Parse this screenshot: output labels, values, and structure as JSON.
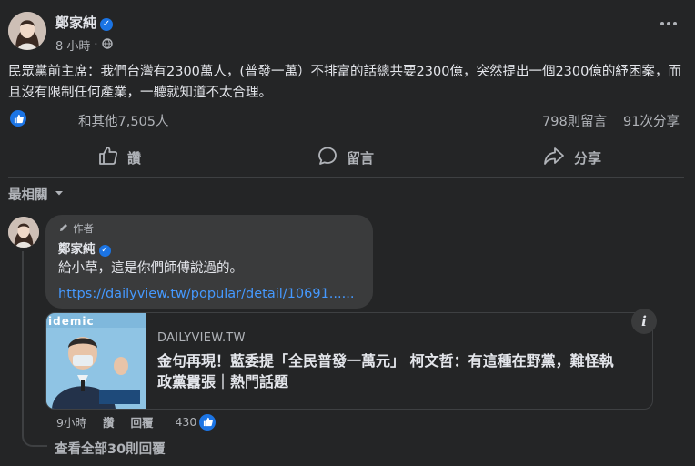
{
  "post": {
    "author": "鄭家純",
    "time": "8 小時",
    "text": "民眾黨前主席：我們台灣有2300萬人，(普發一萬）不排富的話總共要2300億，突然提出一個2300億的紓困案，而且沒有限制任何產業，一聽就知道不太合理。",
    "reactions": "和其他7,505人",
    "comments_count": "798則留言",
    "shares_count": "91次分享"
  },
  "actions": {
    "like": "讚",
    "comment": "留言",
    "share": "分享"
  },
  "sort": {
    "label": "最相關"
  },
  "comment": {
    "badge": "作者",
    "author": "鄭家純",
    "text": "給小草，這是你們師傅說過的。",
    "link": "https://dailyview.tw/popular/detail/10691......",
    "time": "9小時",
    "like": "讚",
    "reply": "回覆",
    "likes": "430",
    "preview": {
      "domain": "DAILYVIEW.TW",
      "title": "金句再現！藍委提「全民普發一萬元」 柯文哲：有這種在野黨，難怪執政黨囂張｜熱門話題",
      "image_banner": "idemic"
    }
  },
  "view_replies": "查看全部30則回覆",
  "colors": {
    "accent": "#1b74e4",
    "link": "#4599ff",
    "background": "#242526"
  }
}
